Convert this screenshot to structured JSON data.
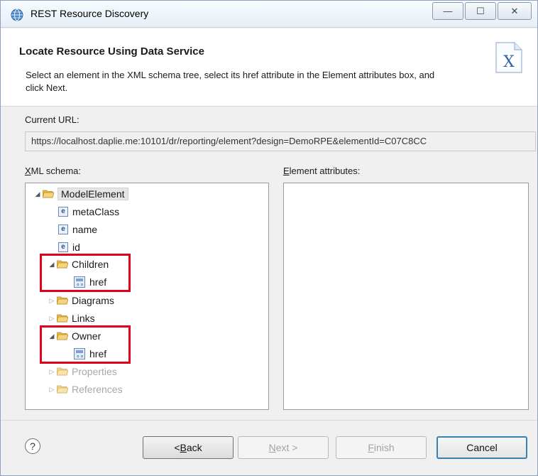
{
  "window": {
    "title": "REST Resource Discovery",
    "controls": {
      "minimize": "—",
      "maximize": "☐",
      "close": "✕"
    }
  },
  "banner": {
    "title": "Locate Resource Using Data Service",
    "description": "Select an element in the XML schema tree, select its href attribute in the Element attributes box, and click Next.",
    "icon": "xml-file-icon"
  },
  "current_url": {
    "label": "Current URL:",
    "value": "https://localhost.daplie.me:10101/dr/reporting/element?design=DemoRPE&elementId=C07C8CC"
  },
  "xml_schema": {
    "label_prefix": "X",
    "label_rest": "ML schema:",
    "tree": [
      {
        "label": "ModelElement",
        "type": "folder",
        "expanded": true
      },
      {
        "label": "metaClass",
        "type": "element",
        "icon_glyph": "e"
      },
      {
        "label": "name",
        "type": "element",
        "icon_glyph": "e"
      },
      {
        "label": "id",
        "type": "element",
        "icon_glyph": "e"
      },
      {
        "label": "Children",
        "type": "folder",
        "expanded": true
      },
      {
        "label": "href",
        "type": "attribute"
      },
      {
        "label": "Diagrams",
        "type": "folder",
        "expanded": false
      },
      {
        "label": "Links",
        "type": "folder",
        "expanded": false
      },
      {
        "label": "Owner",
        "type": "folder",
        "expanded": true
      },
      {
        "label": "href",
        "type": "attribute"
      },
      {
        "label": "Properties",
        "type": "folder",
        "expanded": false,
        "disabled": true
      },
      {
        "label": "References",
        "type": "folder",
        "expanded": false,
        "disabled": true
      }
    ]
  },
  "element_attributes": {
    "label_prefix": "E",
    "label_rest": "lement attributes:"
  },
  "footer": {
    "help": "?",
    "back_prefix": "< ",
    "back_underline": "B",
    "back_rest": "ack",
    "next_underline": "N",
    "next_rest": "ext >",
    "finish_underline": "F",
    "finish_rest": "inish",
    "cancel": "Cancel"
  },
  "colors": {
    "highlight": "#e0001b",
    "folder": "#f2c14e",
    "accent": "#3c7fb1"
  }
}
